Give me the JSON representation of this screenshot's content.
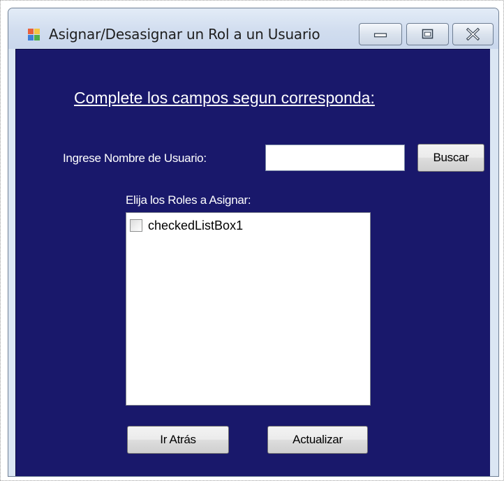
{
  "window": {
    "title": "Asignar/Desasignar un Rol a un Usuario",
    "icon": "winforms-app-icon",
    "controls": {
      "minimize_icon": "minimize-icon",
      "maximize_icon": "maximize-icon",
      "close_icon": "close-icon"
    }
  },
  "form": {
    "heading": "Complete los campos segun corresponda:",
    "user_label": "Ingrese Nombre de Usuario:",
    "user_input": {
      "value": "",
      "placeholder": ""
    },
    "search_button": "Buscar",
    "roles_label": "Elija los Roles a Asignar:",
    "roles_list": {
      "items": [
        {
          "label": "checkedListBox1",
          "checked": false
        }
      ]
    },
    "back_button": "Ir Atrás",
    "update_button": "Actualizar"
  },
  "colors": {
    "form_background": "#19186b",
    "label_text": "#ffffff"
  }
}
